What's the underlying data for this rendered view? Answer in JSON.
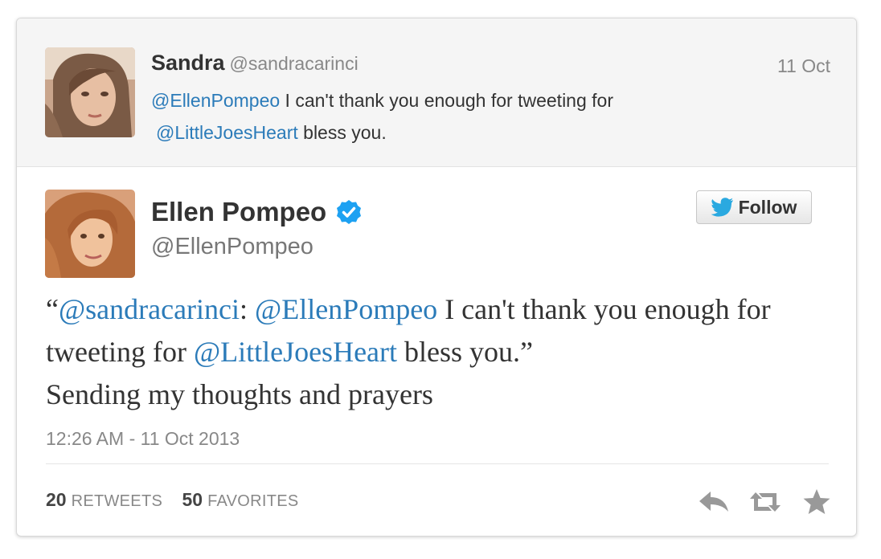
{
  "parent_tweet": {
    "name": "Sandra",
    "handle": "@sandracarinci",
    "date": "11 Oct",
    "text": {
      "mention1": "@EllenPompeo",
      "part1": " I can't thank you enough for tweeting for ",
      "mention2": "@LittleJoesHeart",
      "part2": " bless you."
    }
  },
  "main_tweet": {
    "name": "Ellen Pompeo",
    "handle": "@EllenPompeo",
    "verified_icon": "verified-badge-icon",
    "follow_label": "Follow",
    "text": {
      "open_quote": "“",
      "mention1": "@sandracarinci",
      "colon": ": ",
      "mention2": "@EllenPompeo",
      "part1": " I can't thank you enough for tweeting for ",
      "mention3": "@LittleJoesHeart",
      "part2": " bless you.”",
      "part3": "Sending my thoughts and prayers"
    },
    "timestamp": "12:26 AM - 11 Oct 2013",
    "stats": {
      "retweets_count": "20",
      "retweets_label": "RETWEETS",
      "favorites_count": "50",
      "favorites_label": "FAVORITES"
    },
    "actions": [
      "reply-icon",
      "retweet-icon",
      "favorite-star-icon"
    ]
  },
  "colors": {
    "mention": "#2b7bb9",
    "verified": "#1da1f2",
    "twitter_bird": "#2aa9e0",
    "action_icons": "#999999"
  }
}
